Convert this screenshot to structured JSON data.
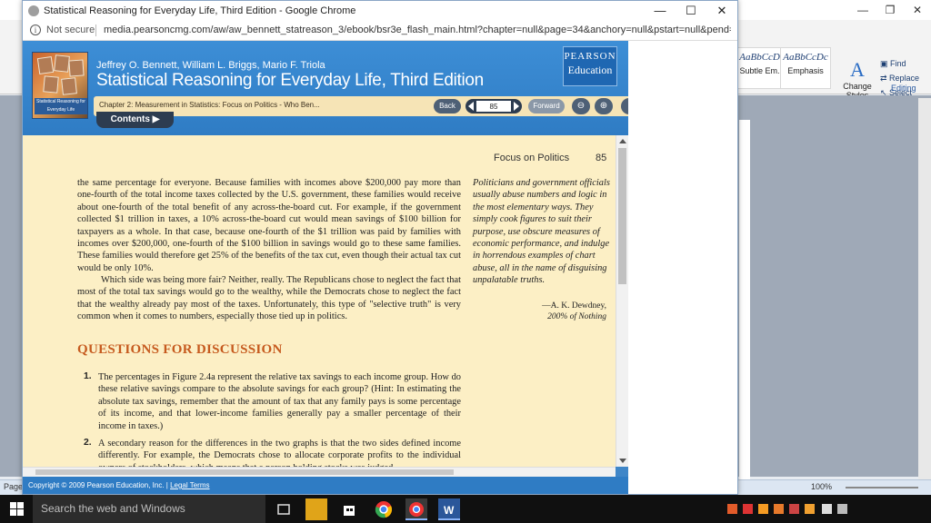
{
  "word": {
    "styles": [
      {
        "preview": "AaBbCcDc",
        "name": "Subtle Em..."
      },
      {
        "preview": "AaBbCcDc",
        "name": "Emphasis"
      }
    ],
    "change_styles": "Change Styles",
    "change_styles_icon": "A",
    "editing": {
      "find": "Find",
      "replace": "Replace",
      "select": "Select",
      "group": "Editing"
    },
    "status": {
      "page": "Page",
      "zoom": "100%"
    }
  },
  "chrome": {
    "title": "Statistical Reasoning for Everyday Life, Third Edition - Google Chrome",
    "not_secure": "Not secure",
    "url": "media.pearsoncmg.com/aw/aw_bennett_statreason_3/ebook/bsr3e_flash_main.html?chapter=null&page=34&anchory=null&pstart=null&pend=n..."
  },
  "app": {
    "authors": "Jeffrey O. Bennett, William L. Briggs, Mario F. Triola",
    "book_title": "Statistical Reasoning for Everyday Life, Third Edition",
    "cover_text": "Statistical Reasoning for Everyday Life",
    "publisher_line1": "PEARSON",
    "publisher_line2": "Education",
    "chapter": "Chapter 2: Measurement in Statistics: Focus on Politics - Who Ben...",
    "back": "Back",
    "forward": "Forward",
    "page_value": "85",
    "contents": "Contents",
    "footer_copyright": "Copyright © 2009 Pearson Education, Inc.",
    "footer_sep": " | ",
    "footer_legal": "Legal Terms"
  },
  "page": {
    "running_head": "Focus on Politics",
    "number": "85",
    "para1": "the same percentage for everyone. Because families with incomes above $200,000 pay more than one-fourth of the total income taxes collected by the U.S. government, these families would receive about one-fourth of the total benefit of any across-the-board cut. For example, if the government collected $1 trillion in taxes, a 10% across-the-board cut would mean savings of $100 billion for taxpayers as a whole. In that case, because one-fourth of the $1 trillion was paid by families with incomes over $200,000, one-fourth of the $100 billion in savings would go to these same families. These families would therefore get 25% of the benefits of the tax cut, even though their actual tax cut would be only 10%.",
    "para2": "Which side was being more fair? Neither, really. The Republicans chose to neglect the fact that most of the total tax savings would go to the wealthy, while the Democrats chose to neglect the fact that the wealthy already pay most of the taxes. Unfortunately, this type of \"selective truth\" is very common when it comes to numbers, especially those tied up in politics.",
    "quote": "Politicians and government officials usually abuse numbers and logic in the most elementary ways. They simply cook figures to suit their purpose, use obscure measures of economic performance, and indulge in horrendous examples of chart abuse, all in the name of disguising unpalatable truths.",
    "quote_author": "—A. K. Dewdney,",
    "quote_source": "200% of Nothing",
    "questions_heading": "QUESTIONS FOR DISCUSSION",
    "q1_num": "1.",
    "q1": "The percentages in Figure 2.4a represent the relative tax savings to each income group. How do these relative savings compare to the absolute savings for each group? (Hint: In estimating the absolute tax savings, remember that the amount of tax that any family pays is some percentage of its income, and that lower-income families generally pay a smaller percentage of their income in taxes.)",
    "q2_num": "2.",
    "q2": "A secondary reason for the differences in the two graphs is that the two sides defined income differently. For example, the Democrats chose to allocate corporate profits to the individual owners of stockholders, which means that a person holding stocks was judged"
  },
  "taskbar": {
    "search_placeholder": "Search the web and Windows"
  }
}
